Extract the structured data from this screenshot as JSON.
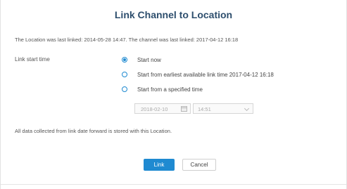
{
  "dialog": {
    "title": "Link Channel to Location",
    "info": "The Location was last linked: 2014-05-28 14:47. The channel was last linked: 2017-04-12 16:18",
    "link_start_label": "Link start time",
    "options": [
      {
        "label": "Start now",
        "selected": true
      },
      {
        "label": "Start from earliest available link time 2017-04-12 16:18",
        "selected": false
      },
      {
        "label": "Start from a specified time",
        "selected": false
      }
    ],
    "date_value": "2018-02-10",
    "time_value": "14:51",
    "footer_note": "All data collected from link date forward is stored with this Location.",
    "link_button": "Link",
    "cancel_button": "Cancel"
  },
  "colors": {
    "accent": "#1f8ad1",
    "title": "#2d4e6d"
  }
}
